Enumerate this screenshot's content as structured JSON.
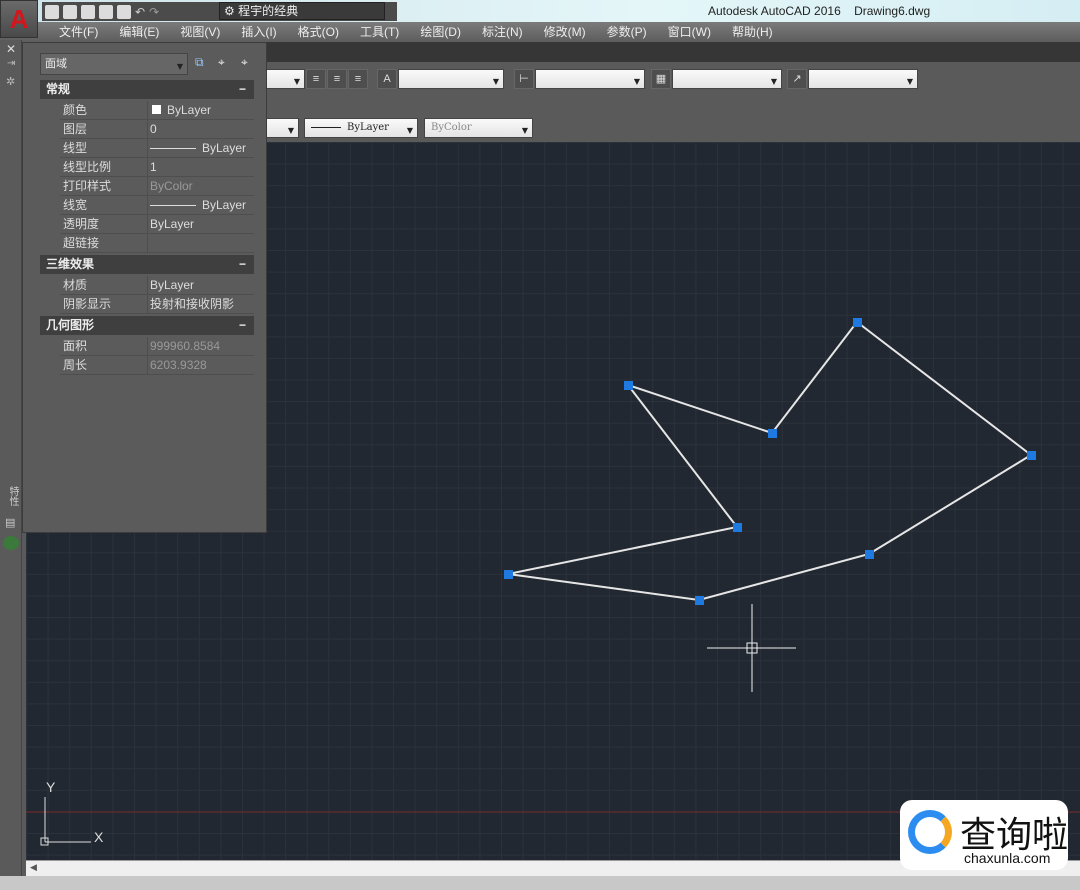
{
  "app": {
    "logo": "A",
    "window_title": "Autodesk AutoCAD 2016    Drawing6.dwg",
    "workspace": "程宇的经典"
  },
  "menu": [
    "文件(F)",
    "编辑(E)",
    "视图(V)",
    "插入(I)",
    "格式(O)",
    "工具(T)",
    "绘图(D)",
    "标注(N)",
    "修改(M)",
    "参数(P)",
    "窗口(W)",
    "帮助(H)"
  ],
  "toolbar": {
    "linetype": "ByLayer",
    "plotstyle": "ByColor"
  },
  "properties": {
    "object_type": "面域",
    "sections": [
      {
        "title": "常规",
        "rows": [
          [
            "颜色",
            "ByLayer"
          ],
          [
            "图层",
            "0"
          ],
          [
            "线型",
            "ByLayer"
          ],
          [
            "线型比例",
            "1"
          ],
          [
            "打印样式",
            "ByColor"
          ],
          [
            "线宽",
            "ByLayer"
          ],
          [
            "透明度",
            "ByLayer"
          ],
          [
            "超链接",
            ""
          ]
        ]
      },
      {
        "title": "三维效果",
        "rows": [
          [
            "材质",
            "ByLayer"
          ],
          [
            "阴影显示",
            "投射和接收阴影"
          ]
        ]
      },
      {
        "title": "几何图形",
        "rows": [
          [
            "面积",
            "999960.8584"
          ],
          [
            "周长",
            "6203.9328"
          ]
        ]
      }
    ],
    "collapse": "−",
    "side_label": "特性"
  },
  "ucs": {
    "x": "X",
    "y": "Y"
  },
  "watermark": {
    "name": "查询啦",
    "url": "chaxunla.com"
  },
  "colors": {
    "grid_bg": "#212831",
    "grip": "#1e7ae0",
    "polyline": "#e6e6e6"
  }
}
